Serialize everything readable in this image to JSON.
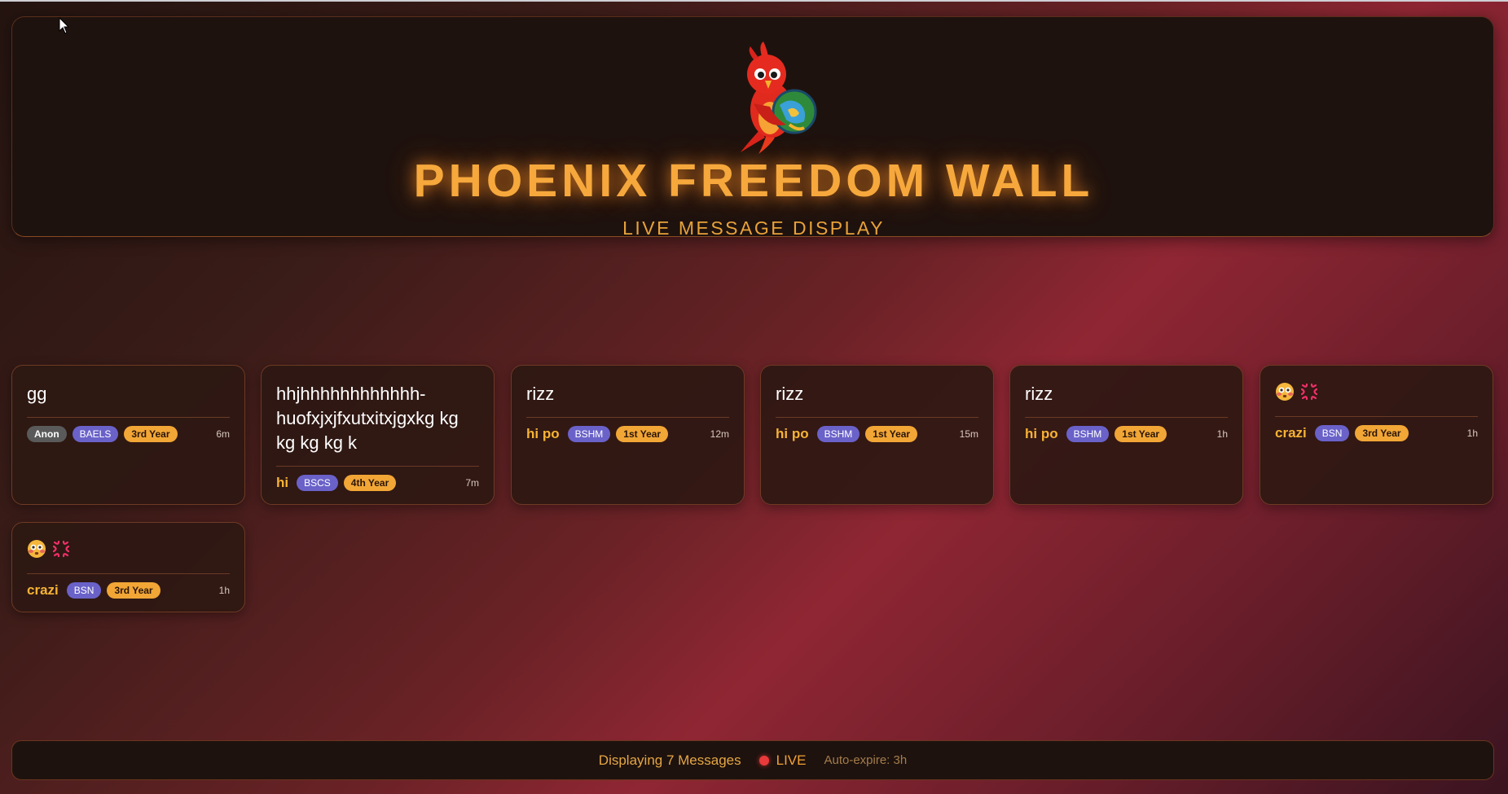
{
  "header": {
    "title": "PHOENIX FREEDOM WALL",
    "subtitle": "LIVE MESSAGE DISPLAY",
    "logo_icon": "phoenix-globe-logo"
  },
  "messages": [
    {
      "text": "gg",
      "author": "Anon",
      "anonymous": true,
      "course": "BAELS",
      "year": "3rd Year",
      "time": "6m"
    },
    {
      "text": "hhjhhhhhhhhhhhh-huofxjxjfxutxitxjgxkg kg kg kg kg k",
      "author": "hi",
      "anonymous": false,
      "course": "BSCS",
      "year": "4th Year",
      "time": "7m"
    },
    {
      "text": "rizz",
      "author": "hi po",
      "anonymous": false,
      "course": "BSHM",
      "year": "1st Year",
      "time": "12m"
    },
    {
      "text": "rizz",
      "author": "hi po",
      "anonymous": false,
      "course": "BSHM",
      "year": "1st Year",
      "time": "15m"
    },
    {
      "text": "rizz",
      "author": "hi po",
      "anonymous": false,
      "course": "BSHM",
      "year": "1st Year",
      "time": "1h"
    },
    {
      "text": "",
      "emojis": [
        "flushed-face-icon",
        "anger-symbol-icon"
      ],
      "author": "crazi",
      "anonymous": false,
      "course": "BSN",
      "year": "3rd Year",
      "time": "1h"
    },
    {
      "text": "",
      "emojis": [
        "flushed-face-icon",
        "anger-symbol-icon"
      ],
      "author": "crazi",
      "anonymous": false,
      "course": "BSN",
      "year": "3rd Year",
      "time": "1h"
    }
  ],
  "footer": {
    "count_text": "Displaying 7 Messages",
    "live_label": "LIVE",
    "expire_text": "Auto-expire: 3h"
  },
  "colors": {
    "accent": "#f6a83c",
    "course_badge": "#6a62c9",
    "year_badge": "#f2a636",
    "live_dot": "#e83a3a"
  }
}
